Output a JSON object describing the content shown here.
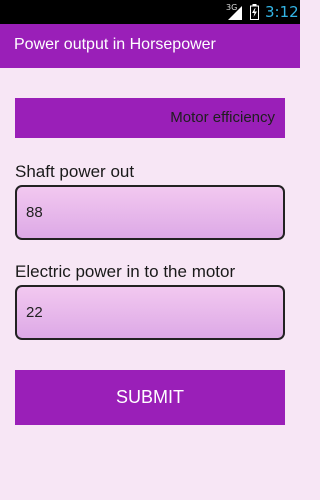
{
  "status_bar": {
    "network": "3G",
    "time": "3:12",
    "icons": [
      "signal-icon",
      "battery-icon"
    ]
  },
  "action_bar": {
    "title": "Power output in Horsepower"
  },
  "efficiency": {
    "label": "Motor efficiency"
  },
  "shaft_power": {
    "label": "Shaft power out",
    "value": "88"
  },
  "electric_power": {
    "label": "Electric power in to the motor",
    "value": "22"
  },
  "submit": {
    "label": "SUBMIT"
  },
  "colors": {
    "accent": "#9a1fb8",
    "background": "#f7e6f5",
    "clock": "#33b5e5"
  }
}
